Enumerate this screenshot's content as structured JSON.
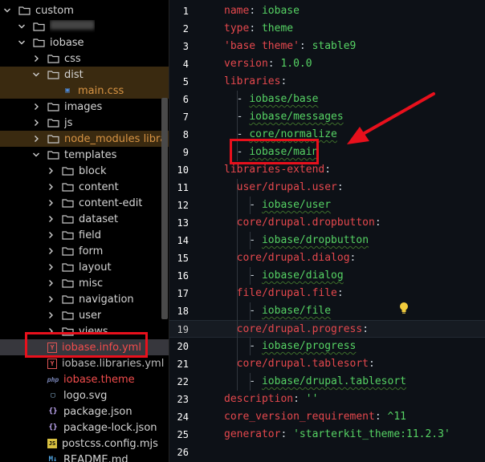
{
  "sidebar": {
    "rows": [
      {
        "id": "custom",
        "label": "custom",
        "indent": 0,
        "type": "folder",
        "open": true
      },
      {
        "id": "redacted",
        "label": "",
        "indent": 1,
        "type": "folder",
        "open": true,
        "redacted": true
      },
      {
        "id": "iobase",
        "label": "iobase",
        "indent": 1,
        "type": "folder",
        "open": true
      },
      {
        "id": "css",
        "label": "css",
        "indent": 2,
        "type": "folder",
        "open": false
      },
      {
        "id": "dist",
        "label": "dist",
        "indent": 2,
        "type": "folder",
        "open": true
      },
      {
        "id": "main-css",
        "label": "main.css",
        "indent": 3,
        "type": "file",
        "icon": "css-file-icon"
      },
      {
        "id": "images",
        "label": "images",
        "indent": 2,
        "type": "folder",
        "open": false
      },
      {
        "id": "js",
        "label": "js",
        "indent": 2,
        "type": "folder",
        "open": false
      },
      {
        "id": "node-modules",
        "label": "node_modules  libra",
        "indent": 2,
        "type": "folder",
        "open": false
      },
      {
        "id": "templates",
        "label": "templates",
        "indent": 2,
        "type": "folder",
        "open": true
      },
      {
        "id": "block",
        "label": "block",
        "indent": 3,
        "type": "folder",
        "open": false
      },
      {
        "id": "content",
        "label": "content",
        "indent": 3,
        "type": "folder",
        "open": false
      },
      {
        "id": "content-edit",
        "label": "content-edit",
        "indent": 3,
        "type": "folder",
        "open": false
      },
      {
        "id": "dataset",
        "label": "dataset",
        "indent": 3,
        "type": "folder",
        "open": false
      },
      {
        "id": "field",
        "label": "field",
        "indent": 3,
        "type": "folder",
        "open": false
      },
      {
        "id": "form",
        "label": "form",
        "indent": 3,
        "type": "folder",
        "open": false
      },
      {
        "id": "layout",
        "label": "layout",
        "indent": 3,
        "type": "folder",
        "open": false
      },
      {
        "id": "misc",
        "label": "misc",
        "indent": 3,
        "type": "folder",
        "open": false
      },
      {
        "id": "navigation",
        "label": "navigation",
        "indent": 3,
        "type": "folder",
        "open": false
      },
      {
        "id": "user",
        "label": "user",
        "indent": 3,
        "type": "folder",
        "open": false
      },
      {
        "id": "views",
        "label": "views",
        "indent": 3,
        "type": "folder",
        "open": false
      },
      {
        "id": "iobase-info",
        "label": "iobase.info.yml",
        "indent": 2,
        "type": "file",
        "icon": "yaml-file-icon"
      },
      {
        "id": "iobase-libraries",
        "label": "iobase.libraries.yml",
        "indent": 2,
        "type": "file",
        "icon": "yaml-file-icon"
      },
      {
        "id": "iobase-theme",
        "label": "iobase.theme",
        "indent": 2,
        "type": "file",
        "icon": "php-file-icon"
      },
      {
        "id": "logo-svg",
        "label": "logo.svg",
        "indent": 2,
        "type": "file",
        "icon": "image-file-icon"
      },
      {
        "id": "package-json",
        "label": "package.json",
        "indent": 2,
        "type": "file",
        "icon": "json-file-icon"
      },
      {
        "id": "package-lock",
        "label": "package-lock.json",
        "indent": 2,
        "type": "file",
        "icon": "json-file-icon"
      },
      {
        "id": "postcss",
        "label": "postcss.config.mjs",
        "indent": 2,
        "type": "file",
        "icon": "js-file-icon"
      },
      {
        "id": "readme",
        "label": "README.md",
        "indent": 2,
        "type": "file",
        "icon": "markdown-file-icon"
      }
    ],
    "icon_glyphs": {
      "php": "php",
      "yaml": "Y",
      "js": "JS",
      "json": "{}",
      "markdown": "M↓",
      "image": "▢",
      "css": "▣"
    }
  },
  "editor": {
    "lines": [
      [
        {
          "t": "name",
          "c": "k"
        },
        {
          "t": ": ",
          "c": "p"
        },
        {
          "t": "iobase",
          "c": "v"
        }
      ],
      [
        {
          "t": "type",
          "c": "k"
        },
        {
          "t": ": ",
          "c": "p"
        },
        {
          "t": "theme",
          "c": "v"
        }
      ],
      [
        {
          "t": "'base theme'",
          "c": "k"
        },
        {
          "t": ": ",
          "c": "p"
        },
        {
          "t": "stable9",
          "c": "v"
        }
      ],
      [
        {
          "t": "version",
          "c": "k"
        },
        {
          "t": ": ",
          "c": "p"
        },
        {
          "t": "1.0.0",
          "c": "v"
        }
      ],
      [
        {
          "t": "libraries",
          "c": "k"
        },
        {
          "t": ":",
          "c": "p"
        }
      ],
      [
        {
          "t": "  - ",
          "c": "p"
        },
        {
          "t": "iobase/base",
          "c": "v sq"
        }
      ],
      [
        {
          "t": "  - ",
          "c": "p"
        },
        {
          "t": "iobase/messages",
          "c": "v sq"
        }
      ],
      [
        {
          "t": "  - ",
          "c": "p"
        },
        {
          "t": "core/normalize",
          "c": "v sq"
        }
      ],
      [
        {
          "t": "  - ",
          "c": "p"
        },
        {
          "t": "iobase/main",
          "c": "v sq"
        }
      ],
      [
        {
          "t": "libraries-extend",
          "c": "k"
        },
        {
          "t": ":",
          "c": "p"
        }
      ],
      [
        {
          "t": "  user/drupal.user",
          "c": "k"
        },
        {
          "t": ":",
          "c": "p"
        }
      ],
      [
        {
          "t": "    - ",
          "c": "p"
        },
        {
          "t": "iobase/user",
          "c": "v sq"
        }
      ],
      [
        {
          "t": "  core/drupal.dropbutton",
          "c": "k"
        },
        {
          "t": ":",
          "c": "p"
        }
      ],
      [
        {
          "t": "    - ",
          "c": "p"
        },
        {
          "t": "iobase/dropbutton",
          "c": "v sq"
        }
      ],
      [
        {
          "t": "  core/drupal.dialog",
          "c": "k"
        },
        {
          "t": ":",
          "c": "p"
        }
      ],
      [
        {
          "t": "    - ",
          "c": "p"
        },
        {
          "t": "iobase/dialog",
          "c": "v sq"
        }
      ],
      [
        {
          "t": "  file/drupal.file",
          "c": "k"
        },
        {
          "t": ":",
          "c": "p"
        }
      ],
      [
        {
          "t": "    - ",
          "c": "p"
        },
        {
          "t": "iobase/file",
          "c": "v sq"
        }
      ],
      [
        {
          "t": "  core/drupal.progress",
          "c": "k"
        },
        {
          "t": ":",
          "c": "p"
        }
      ],
      [
        {
          "t": "    - ",
          "c": "p"
        },
        {
          "t": "iobase/progress",
          "c": "v sq"
        }
      ],
      [
        {
          "t": "  core/drupal.tablesort",
          "c": "k"
        },
        {
          "t": ":",
          "c": "p"
        }
      ],
      [
        {
          "t": "    - ",
          "c": "p"
        },
        {
          "t": "iobase/drupal.tablesort",
          "c": "v sq"
        }
      ],
      [
        {
          "t": "description",
          "c": "k"
        },
        {
          "t": ": ",
          "c": "p"
        },
        {
          "t": "''",
          "c": "s"
        }
      ],
      [
        {
          "t": "core_version_requirement",
          "c": "k"
        },
        {
          "t": ": ",
          "c": "p"
        },
        {
          "t": "^11",
          "c": "v"
        }
      ],
      [
        {
          "t": "generator",
          "c": "k"
        },
        {
          "t": ": ",
          "c": "p"
        },
        {
          "t": "'starterkit_theme:11.2.3'",
          "c": "s"
        }
      ],
      []
    ],
    "current_line": 19
  },
  "colors": {
    "highlight": "#e8101c",
    "key": "#e5484d",
    "value": "#56d364"
  }
}
